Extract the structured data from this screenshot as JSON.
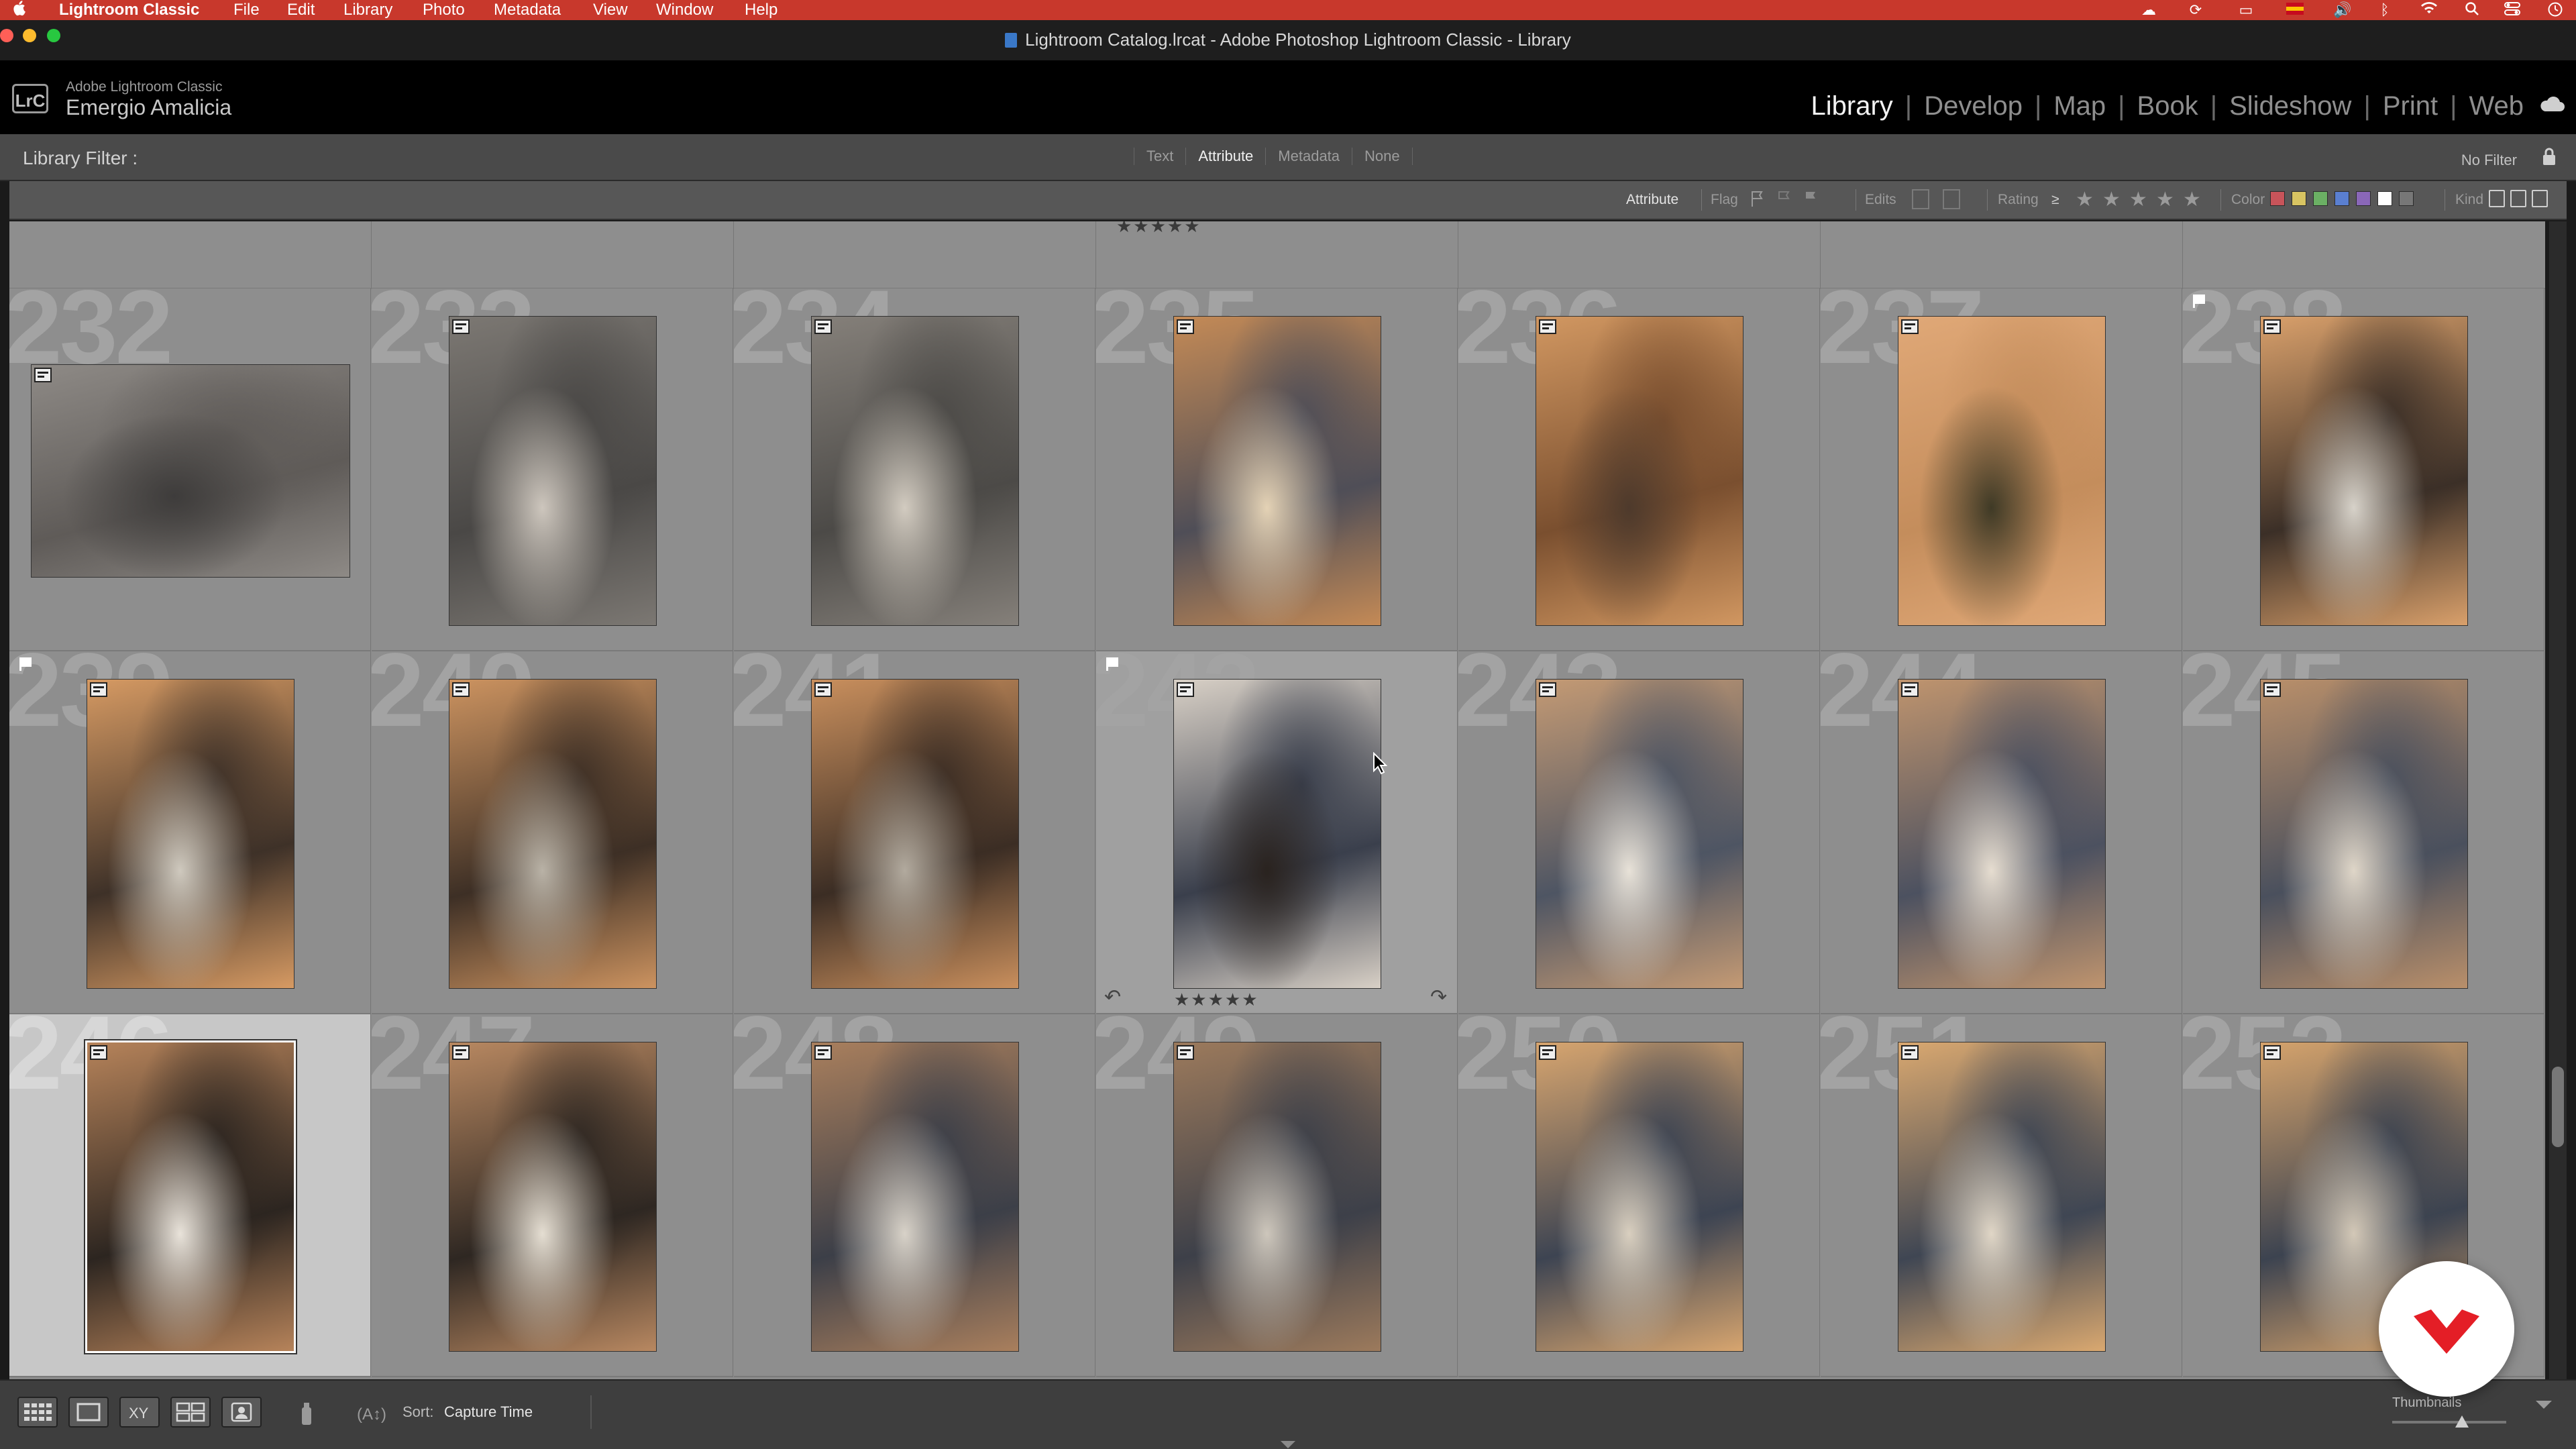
{
  "menubar": {
    "app_name": "Lightroom Classic",
    "items": [
      "File",
      "Edit",
      "Library",
      "Photo",
      "Metadata",
      "View",
      "Window",
      "Help"
    ],
    "status_icons": [
      "creative-cloud-icon",
      "sync-icon",
      "display-icon",
      "flag-icon",
      "volume-icon",
      "bluetooth-icon",
      "wifi-icon",
      "search-icon",
      "control-center-icon",
      "clock-icon"
    ]
  },
  "window": {
    "title": "Lightroom Catalog.lrcat - Adobe Photoshop Lightroom Classic - Library"
  },
  "identity": {
    "badge": "LrC",
    "product": "Adobe Lightroom Classic",
    "user_name": "Emergio Amalicia"
  },
  "modules": [
    "Library",
    "Develop",
    "Map",
    "Book",
    "Slideshow",
    "Print",
    "Web"
  ],
  "active_module": "Library",
  "filter": {
    "label": "Library Filter :",
    "tabs": [
      "Text",
      "Attribute",
      "Metadata",
      "None"
    ],
    "active_tab": "Attribute",
    "preset": "No Filter"
  },
  "attribute_bar": {
    "title": "Attribute",
    "flag_label": "Flag",
    "edits_label": "Edits",
    "rating_label": "Rating",
    "rating_op": "≥",
    "color_label": "Color",
    "kind_label": "Kind",
    "colors": [
      "#c8545a",
      "#d8c462",
      "#6bb064",
      "#5a7fd0",
      "#8a67b8",
      "#ffffff",
      "#777777"
    ]
  },
  "grid": {
    "partial_top_stars": "★★★★★",
    "cells": [
      {
        "num": "232",
        "orient": "landscape",
        "tone": [
          "#8e8a86",
          "#5f5b58",
          "#3e3c3b"
        ]
      },
      {
        "num": "233",
        "orient": "portrait",
        "tone": [
          "#7c7873",
          "#4a4846",
          "#cdc6bd"
        ]
      },
      {
        "num": "234",
        "orient": "portrait",
        "tone": [
          "#85807a",
          "#4c4a47",
          "#d2cbc0"
        ]
      },
      {
        "num": "235",
        "orient": "portrait",
        "tone": [
          "#c48a56",
          "#4f4e57",
          "#e4d2b5"
        ]
      },
      {
        "num": "236",
        "orient": "portrait",
        "tone": [
          "#d19761",
          "#7a4f2f",
          "#4e3a2c"
        ]
      },
      {
        "num": "237",
        "orient": "portrait",
        "tone": [
          "#e0a877",
          "#c48d5c",
          "#3f3a26"
        ]
      },
      {
        "num": "238",
        "orient": "portrait",
        "tone": [
          "#d9a06b",
          "#3b2f27",
          "#d7d2c9"
        ],
        "flagged": true
      },
      {
        "num": "239",
        "orient": "portrait",
        "tone": [
          "#d69a63",
          "#3e3128",
          "#cfc9be"
        ],
        "flagged": true
      },
      {
        "num": "240",
        "orient": "portrait",
        "tone": [
          "#cc9360",
          "#3d2f25",
          "#b9b2a6"
        ]
      },
      {
        "num": "241",
        "orient": "portrait",
        "tone": [
          "#c98f5d",
          "#3b2d24",
          "#b2aa9e"
        ]
      },
      {
        "num": "242",
        "orient": "portrait",
        "tone": [
          "#d8d0c6",
          "#3a3f4c",
          "#2a231f"
        ],
        "flagged": true,
        "stars": "★★★★★",
        "hover": true
      },
      {
        "num": "243",
        "orient": "portrait",
        "tone": [
          "#c49a74",
          "#4e5563",
          "#e8e2d8"
        ]
      },
      {
        "num": "244",
        "orient": "portrait",
        "tone": [
          "#bf946e",
          "#4c5160",
          "#e6ddd0"
        ]
      },
      {
        "num": "245",
        "orient": "portrait",
        "tone": [
          "#b98f6a",
          "#4a505d",
          "#dfd6c8"
        ]
      },
      {
        "num": "246",
        "orient": "portrait",
        "tone": [
          "#b6835a",
          "#2c2520",
          "#e9e3da"
        ],
        "selected": true
      },
      {
        "num": "247",
        "orient": "portrait",
        "tone": [
          "#b88861",
          "#2e2722",
          "#e5ded2"
        ]
      },
      {
        "num": "248",
        "orient": "portrait",
        "tone": [
          "#a97f5d",
          "#3c3f48",
          "#d8d2c8"
        ]
      },
      {
        "num": "249",
        "orient": "portrait",
        "tone": [
          "#9c7a5c",
          "#3d4049",
          "#cdc6bb"
        ]
      },
      {
        "num": "250",
        "orient": "portrait",
        "tone": [
          "#d7a56f",
          "#3d4452",
          "#d9cfbf"
        ]
      },
      {
        "num": "251",
        "orient": "portrait",
        "tone": [
          "#d9a870",
          "#3f4653",
          "#e0d6c6"
        ]
      },
      {
        "num": "252",
        "orient": "portrait",
        "tone": [
          "#d5a36c",
          "#3c4350",
          "#d3c8b7"
        ]
      }
    ]
  },
  "toolbar": {
    "view_icons": [
      "grid-view-icon",
      "loupe-view-icon",
      "compare-view-icon",
      "survey-view-icon",
      "people-view-icon"
    ],
    "sort_label": "Sort:",
    "sort_value": "Capture Time",
    "thumbnails_label": "Thumbnails"
  }
}
